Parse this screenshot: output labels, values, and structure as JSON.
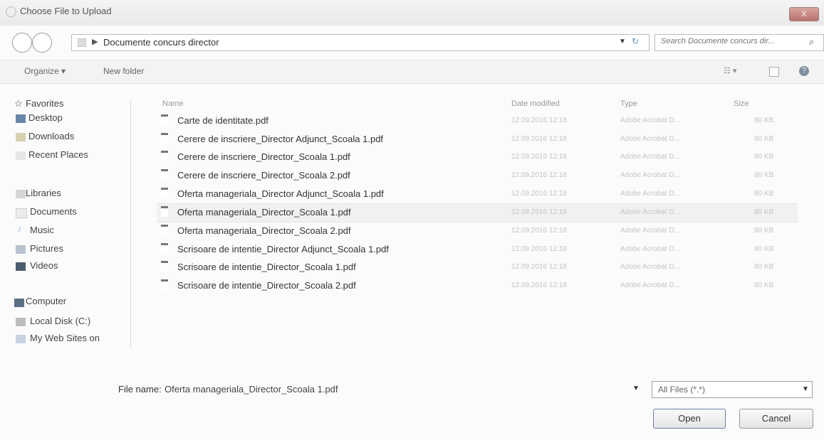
{
  "window": {
    "title": "Choose File to Upload",
    "close_label": "X"
  },
  "nav": {
    "path": "Documente concurs director",
    "search_placeholder": "Search Documente concurs dir..."
  },
  "toolbar": {
    "organize_label": "Organize ▾",
    "new_folder_label": "New folder"
  },
  "sidebar": {
    "favorites_label": "Favorites",
    "favorites": [
      "Desktop",
      "Downloads",
      "Recent Places"
    ],
    "libraries_label": "Libraries",
    "libraries": [
      "Documents",
      "Music",
      "Pictures",
      "Videos"
    ],
    "computer_label": "Computer",
    "computer": [
      "Local Disk (C:)",
      "My Web Sites on"
    ]
  },
  "columns": {
    "name": "Name",
    "date": "Date modified",
    "type": "Type",
    "size": "Size"
  },
  "files": [
    {
      "name": "Carte de identitate.pdf",
      "date": "12.09.2016 12:18",
      "type": "Adobe Acrobat D...",
      "size": "80 KB"
    },
    {
      "name": "Cerere de inscriere_Director Adjunct_Scoala 1.pdf",
      "date": "12.09.2016 12:18",
      "type": "Adobe Acrobat D...",
      "size": "80 KB"
    },
    {
      "name": "Cerere de inscriere_Director_Scoala 1.pdf",
      "date": "12.09.2016 12:18",
      "type": "Adobe Acrobat D...",
      "size": "80 KB"
    },
    {
      "name": "Cerere de inscriere_Director_Scoala 2.pdf",
      "date": "12.09.2016 12:18",
      "type": "Adobe Acrobat D...",
      "size": "80 KB"
    },
    {
      "name": "Oferta manageriala_Director Adjunct_Scoala 1.pdf",
      "date": "12.09.2016 12:18",
      "type": "Adobe Acrobat D...",
      "size": "80 KB"
    },
    {
      "name": "Oferta manageriala_Director_Scoala 1.pdf",
      "date": "12.09.2016 12:18",
      "type": "Adobe Acrobat D...",
      "size": "80 KB"
    },
    {
      "name": "Oferta manageriala_Director_Scoala 2.pdf",
      "date": "12.09.2016 12:18",
      "type": "Adobe Acrobat D...",
      "size": "80 KB"
    },
    {
      "name": "Scrisoare de intentie_Director Adjunct_Scoala 1.pdf",
      "date": "12.09.2016 12:18",
      "type": "Adobe Acrobat D...",
      "size": "80 KB"
    },
    {
      "name": "Scrisoare de intentie_Director_Scoala 1.pdf",
      "date": "12.09.2016 12:18",
      "type": "Adobe Acrobat D...",
      "size": "80 KB"
    },
    {
      "name": "Scrisoare de intentie_Director_Scoala 2.pdf",
      "date": "12.09.2016 12:18",
      "type": "Adobe Acrobat D...",
      "size": "80 KB"
    }
  ],
  "footer": {
    "filename_label": "File name:",
    "filename_value": "Oferta manageriala_Director_Scoala 1.pdf",
    "filetype": "All Files (*.*)",
    "open_label": "Open",
    "cancel_label": "Cancel"
  }
}
